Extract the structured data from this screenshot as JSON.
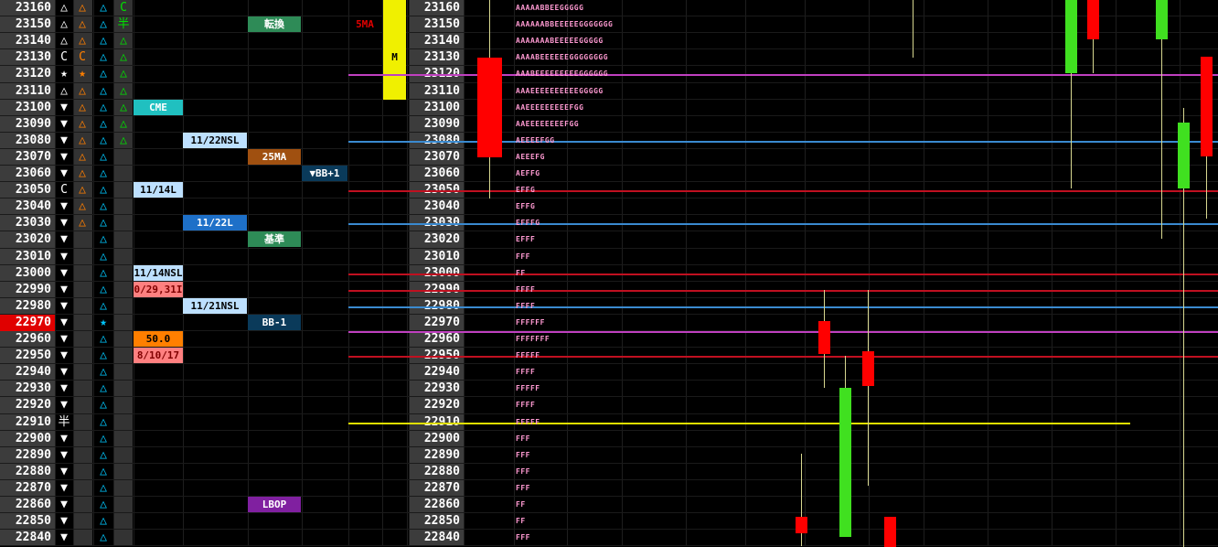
{
  "prices": [
    "23160",
    "23150",
    "23140",
    "23130",
    "23120",
    "23110",
    "23100",
    "23090",
    "23080",
    "23070",
    "23060",
    "23050",
    "23040",
    "23030",
    "23020",
    "23010",
    "23000",
    "22990",
    "22980",
    "22970",
    "22960",
    "22950",
    "22940",
    "22930",
    "22920",
    "22910",
    "22900",
    "22890",
    "22880",
    "22870",
    "22860",
    "22850",
    "22840"
  ],
  "current_price": "22970",
  "col_b": [
    "△",
    "△",
    "△",
    "C",
    "★",
    "△",
    "▼",
    "▼",
    "▼",
    "▼",
    "▼",
    "C",
    "▼",
    "▼",
    "▼",
    "▼",
    "▼",
    "▼",
    "▼",
    "▼",
    "▼",
    "▼",
    "▼",
    "▼",
    "▼",
    "半",
    "▼",
    "▼",
    "▼",
    "▼",
    "▼",
    "▼",
    "▼"
  ],
  "col_c": [
    "△",
    "△",
    "△",
    "C",
    "★",
    "△",
    "△",
    "△",
    "△",
    "△",
    "△",
    "△",
    "△",
    "△",
    "",
    "",
    "",
    "",
    "",
    "",
    "",
    "",
    "",
    "",
    "",
    "",
    "",
    "",
    "",
    "",
    "",
    "",
    ""
  ],
  "col_d": [
    "△",
    "△",
    "△",
    "△",
    "△",
    "△",
    "△",
    "△",
    "△",
    "△",
    "△",
    "△",
    "△",
    "△",
    "△",
    "△",
    "△",
    "△",
    "△",
    "★",
    "△",
    "△",
    "△",
    "△",
    "△",
    "△",
    "△",
    "△",
    "△",
    "△",
    "△",
    "△",
    "△"
  ],
  "col_e": [
    "C",
    "半",
    "△",
    "△",
    "△",
    "△",
    "△",
    "△",
    "△",
    "",
    "",
    "",
    "",
    "",
    "",
    "",
    "",
    "",
    "",
    "",
    "",
    "",
    "",
    "",
    "",
    "",
    "",
    "",
    "",
    "",
    "",
    "",
    ""
  ],
  "colors": {
    "orange": "#ff7f00",
    "white": "#ffffff",
    "cyan": "#00c8ff",
    "green": "#00e000",
    "yellow": "#e0e000"
  },
  "labels": {
    "kanten": "転換",
    "ma5": "5MA",
    "m_marker": "M",
    "cme": "CME",
    "nsl_1122": "11/22NSL",
    "ma25": "25MA",
    "bb_plus1": "▼BB+1",
    "l_1114": "11/14L",
    "l_1122": "11/22L",
    "kijun": "基準",
    "nsl_1114": "11/14NSL",
    "val_2931": "0/29,31I",
    "nsl_1121": "11/21NSL",
    "bb_minus1": "BB-1",
    "val_50": "50.0",
    "val_810": "8/10/17",
    "lbop": "LBOP"
  },
  "tpo": [
    "AAAAABBEEGGGGG",
    "AAAAAABBEEEEEGGGGGGG",
    "AAAAAAABEEEEEGGGGG",
    "AAAABEEEEEEGGGGGGGG",
    "AAABEEEEEEEEEGGGGGG",
    "AAAEEEEEEEEEEGGGGG",
    "AAEEEEEEEEEFGG",
    "AAEEEEEEEEFGG",
    "AEEEEFGG",
    "AEEEFG",
    "AEFFG",
    "EFFG",
    "EFFG",
    "EFFFG",
    "EFFF",
    "FFF",
    "FF",
    "FFFF",
    "FFFF",
    "FFFFFF",
    "FFFFFFF",
    "FFFFF",
    "FFFF",
    "FFFFF",
    "FFFF",
    "FFFFF",
    "FFF",
    "FFF",
    "FFF",
    "FFF",
    "FF",
    "FF",
    "FFF"
  ]
}
